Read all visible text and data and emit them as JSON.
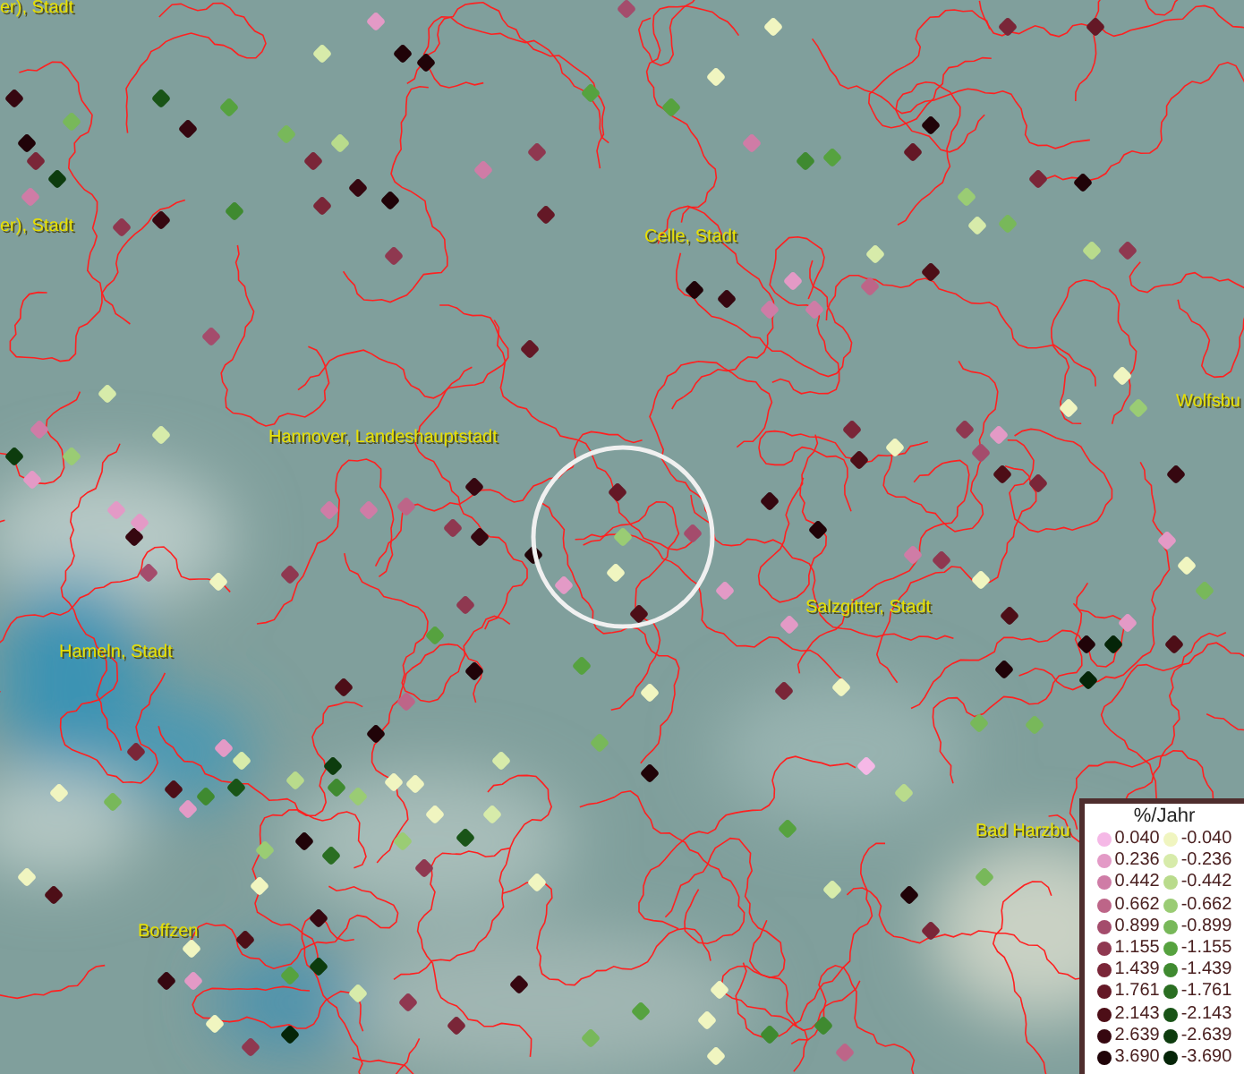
{
  "map": {
    "place_labels": [
      {
        "text": "er), Stadt"
      },
      {
        "text": "er), Stadt"
      },
      {
        "text": "Celle, Stadt"
      },
      {
        "text": "Wolfsbu"
      },
      {
        "text": "Hannover, Landeshauptstadt"
      },
      {
        "text": "Salzgitter, Stadt"
      },
      {
        "text": "Hameln, Stadt"
      },
      {
        "text": "Bad Harzbu"
      },
      {
        "text": "Boffzen"
      }
    ]
  },
  "legend": {
    "title": "%/Jahr",
    "positive": [
      {
        "label": "0.040",
        "color": "#f5b8e6"
      },
      {
        "label": "0.236",
        "color": "#e39ac6"
      },
      {
        "label": "0.442",
        "color": "#cf7ca6"
      },
      {
        "label": "0.662",
        "color": "#bd6588"
      },
      {
        "label": "0.899",
        "color": "#a44c6c"
      },
      {
        "label": "1.155",
        "color": "#8f3850"
      },
      {
        "label": "1.439",
        "color": "#7a2638"
      },
      {
        "label": "1.761",
        "color": "#641826"
      },
      {
        "label": "2.143",
        "color": "#4d0e17"
      },
      {
        "label": "2.639",
        "color": "#360710"
      },
      {
        "label": "3.690",
        "color": "#200308"
      }
    ],
    "negative": [
      {
        "label": "-0.040",
        "color": "#f0f5c0"
      },
      {
        "label": "-0.236",
        "color": "#d7ebaa"
      },
      {
        "label": "-0.442",
        "color": "#b9db8c"
      },
      {
        "label": "-0.662",
        "color": "#9acc74"
      },
      {
        "label": "-0.899",
        "color": "#78b85a"
      },
      {
        "label": "-1.155",
        "color": "#56a23f"
      },
      {
        "label": "-1.439",
        "color": "#3f8a30"
      },
      {
        "label": "-1.761",
        "color": "#2a6e22"
      },
      {
        "label": "-2.143",
        "color": "#195417"
      },
      {
        "label": "-2.639",
        "color": "#0d3c0e"
      },
      {
        "label": "-3.690",
        "color": "#052508"
      }
    ]
  }
}
